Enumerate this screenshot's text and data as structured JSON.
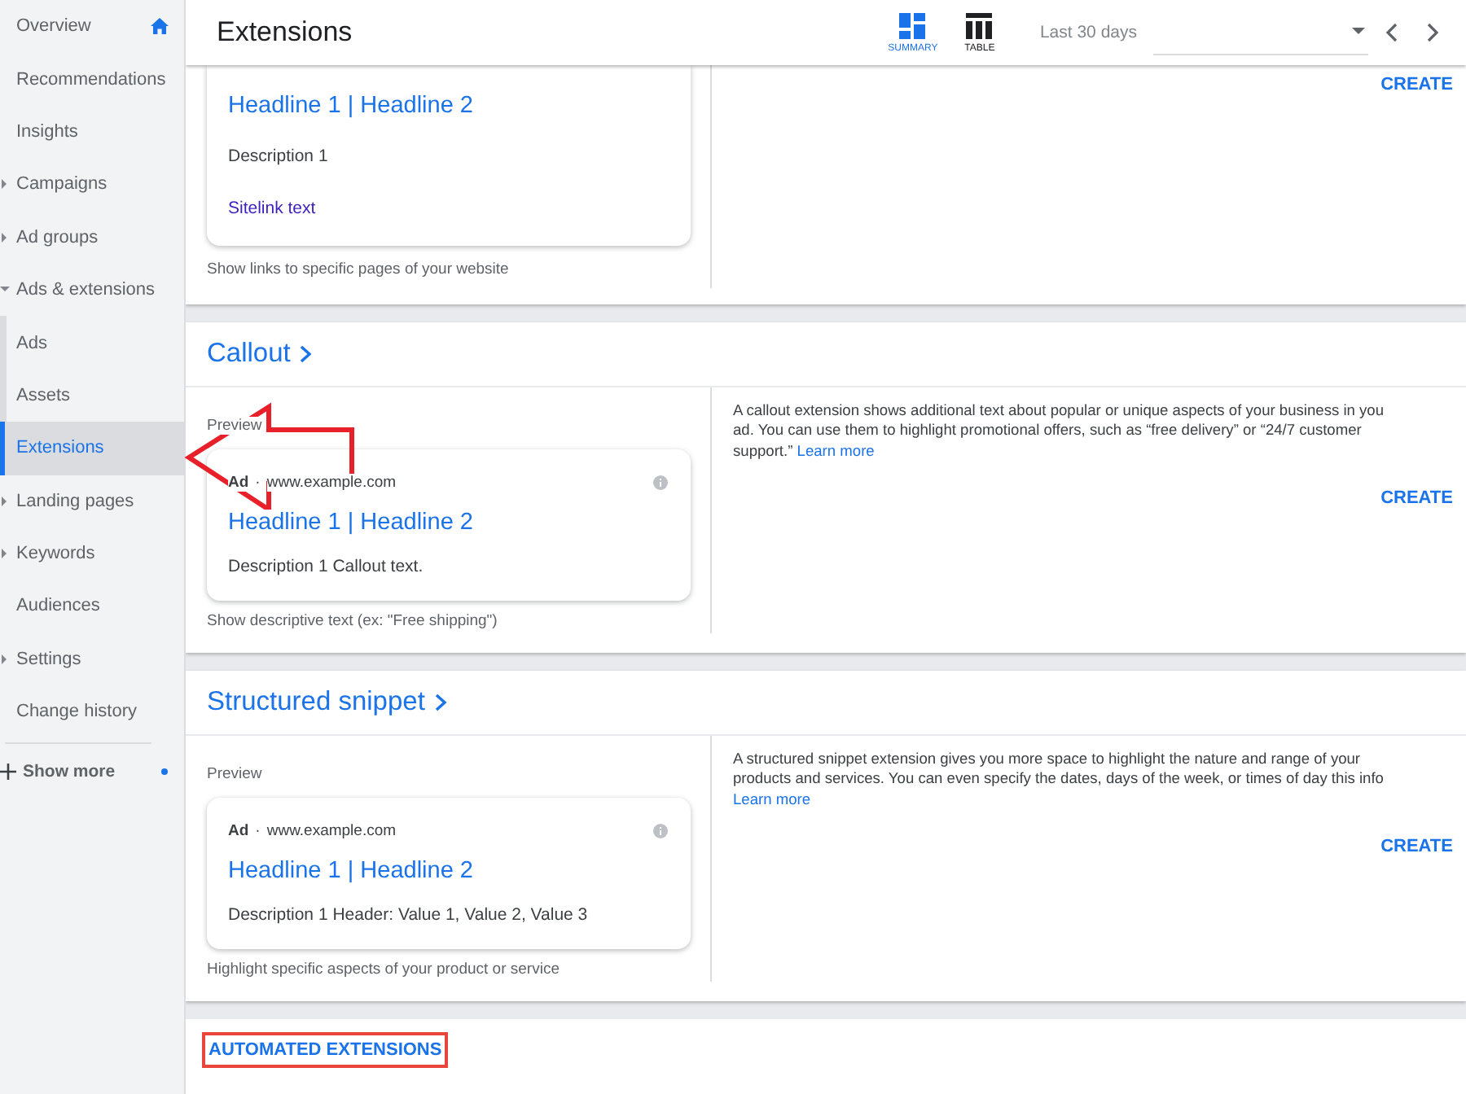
{
  "sidebar": {
    "items": [
      {
        "label": "Overview",
        "kind": "home",
        "selected": false
      },
      {
        "label": "Recommendations",
        "kind": "link",
        "selected": false
      },
      {
        "label": "Insights",
        "kind": "link",
        "selected": false
      },
      {
        "label": "Campaigns",
        "kind": "expandable",
        "expanded": false,
        "selected": false
      },
      {
        "label": "Ad groups",
        "kind": "expandable",
        "expanded": false,
        "selected": false
      },
      {
        "label": "Ads & extensions",
        "kind": "expandable",
        "expanded": true,
        "selected": false,
        "children": [
          {
            "label": "Ads",
            "kind": "link",
            "selected": false
          },
          {
            "label": "Assets",
            "kind": "link",
            "selected": false
          },
          {
            "label": "Extensions",
            "kind": "link",
            "selected": true,
            "annotated": true
          }
        ]
      },
      {
        "label": "Landing pages",
        "kind": "expandable",
        "expanded": false,
        "selected": false
      },
      {
        "label": "Keywords",
        "kind": "expandable",
        "expanded": false,
        "selected": false
      },
      {
        "label": "Audiences",
        "kind": "link",
        "selected": false
      },
      {
        "label": "Settings",
        "kind": "expandable",
        "expanded": false,
        "selected": false
      },
      {
        "label": "Change history",
        "kind": "link",
        "selected": false
      }
    ],
    "show_more": {
      "label": "Show more",
      "has_update": true
    }
  },
  "header": {
    "title": "Extensions",
    "views": [
      {
        "label": "SUMMARY",
        "kind": "summary",
        "selected": true
      },
      {
        "label": "TABLE",
        "kind": "table",
        "selected": false
      }
    ],
    "date_range": {
      "value": "Last 30 days"
    }
  },
  "sections": [
    {
      "kind": "partial",
      "ad": {
        "headline": "Headline 1 | Headline 2",
        "description": "Description 1",
        "sitelink": "Sitelink text"
      },
      "caption": "Show links to specific pages of your website",
      "create": "CREATE"
    },
    {
      "kind": "full",
      "title": "Callout",
      "preview_label": "Preview",
      "ad": {
        "label": "Ad",
        "separator": "·",
        "url": "www.example.com",
        "headline": "Headline 1 | Headline 2",
        "description": "Description 1 Callout text."
      },
      "caption": "Show descriptive text (ex: \"Free shipping\")",
      "info_lines": [
        "A callout extension shows additional text about popular or unique aspects of your business in you",
        "ad. You can use them to highlight promotional offers, such as “free delivery” or “24/7 customer",
        "support.”"
      ],
      "learn_more": "Learn more",
      "create": "CREATE"
    },
    {
      "kind": "full",
      "title": "Structured snippet",
      "preview_label": "Preview",
      "ad": {
        "label": "Ad",
        "separator": "·",
        "url": "www.example.com",
        "headline": "Headline 1 | Headline 2",
        "description": "Description 1 Header: Value 1, Value 2, Value 3"
      },
      "caption": "Highlight specific aspects of your product or service",
      "info_lines": [
        "A structured snippet extension gives you more space to highlight the nature and range of your",
        "products and services. You can even specify the dates, days of the week, or times of day this info"
      ],
      "learn_more": "Learn more",
      "create": "CREATE"
    }
  ],
  "footer": {
    "link": "AUTOMATED EXTENSIONS",
    "highlighted": true
  }
}
